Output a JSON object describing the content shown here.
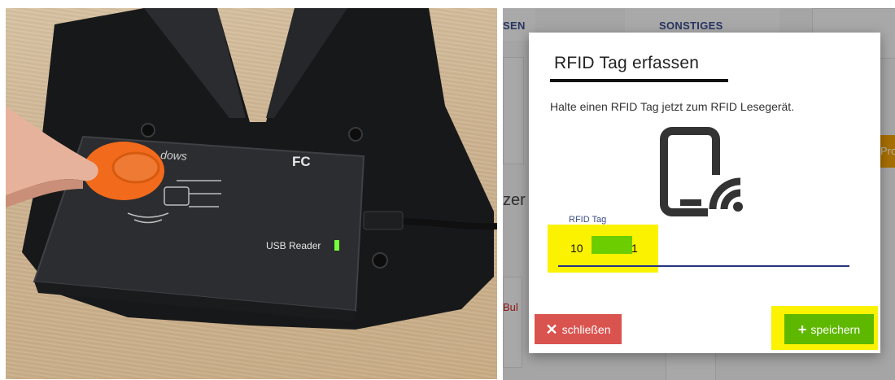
{
  "photo": {
    "reader_brand_fragment": "dows",
    "reader_fcc_mark": "FC",
    "reader_label": "USB Reader"
  },
  "background": {
    "tab_left_fragment": "SEN",
    "tab_sonstiges": "SONSTIGES",
    "text_fragment": "zer",
    "orange_fragment": "Pro",
    "can_fragment": "Bul"
  },
  "dialog": {
    "title": "RFID Tag erfassen",
    "message": "Halte einen RFID Tag jetzt zum RFID Lesegerät.",
    "icon": "phone-nfc-icon",
    "field": {
      "label": "RFID Tag",
      "value_start": "10",
      "value_end": "1"
    },
    "close_button": {
      "icon": "close-icon",
      "label": "schließen",
      "color": "#d9534f"
    },
    "save_button": {
      "icon": "plus-icon",
      "label": "speichern",
      "color": "#5fb800"
    }
  },
  "colors": {
    "annotation_highlight": "#fbf200",
    "redaction": "#6ccd00",
    "accent_blue": "#27337e"
  }
}
